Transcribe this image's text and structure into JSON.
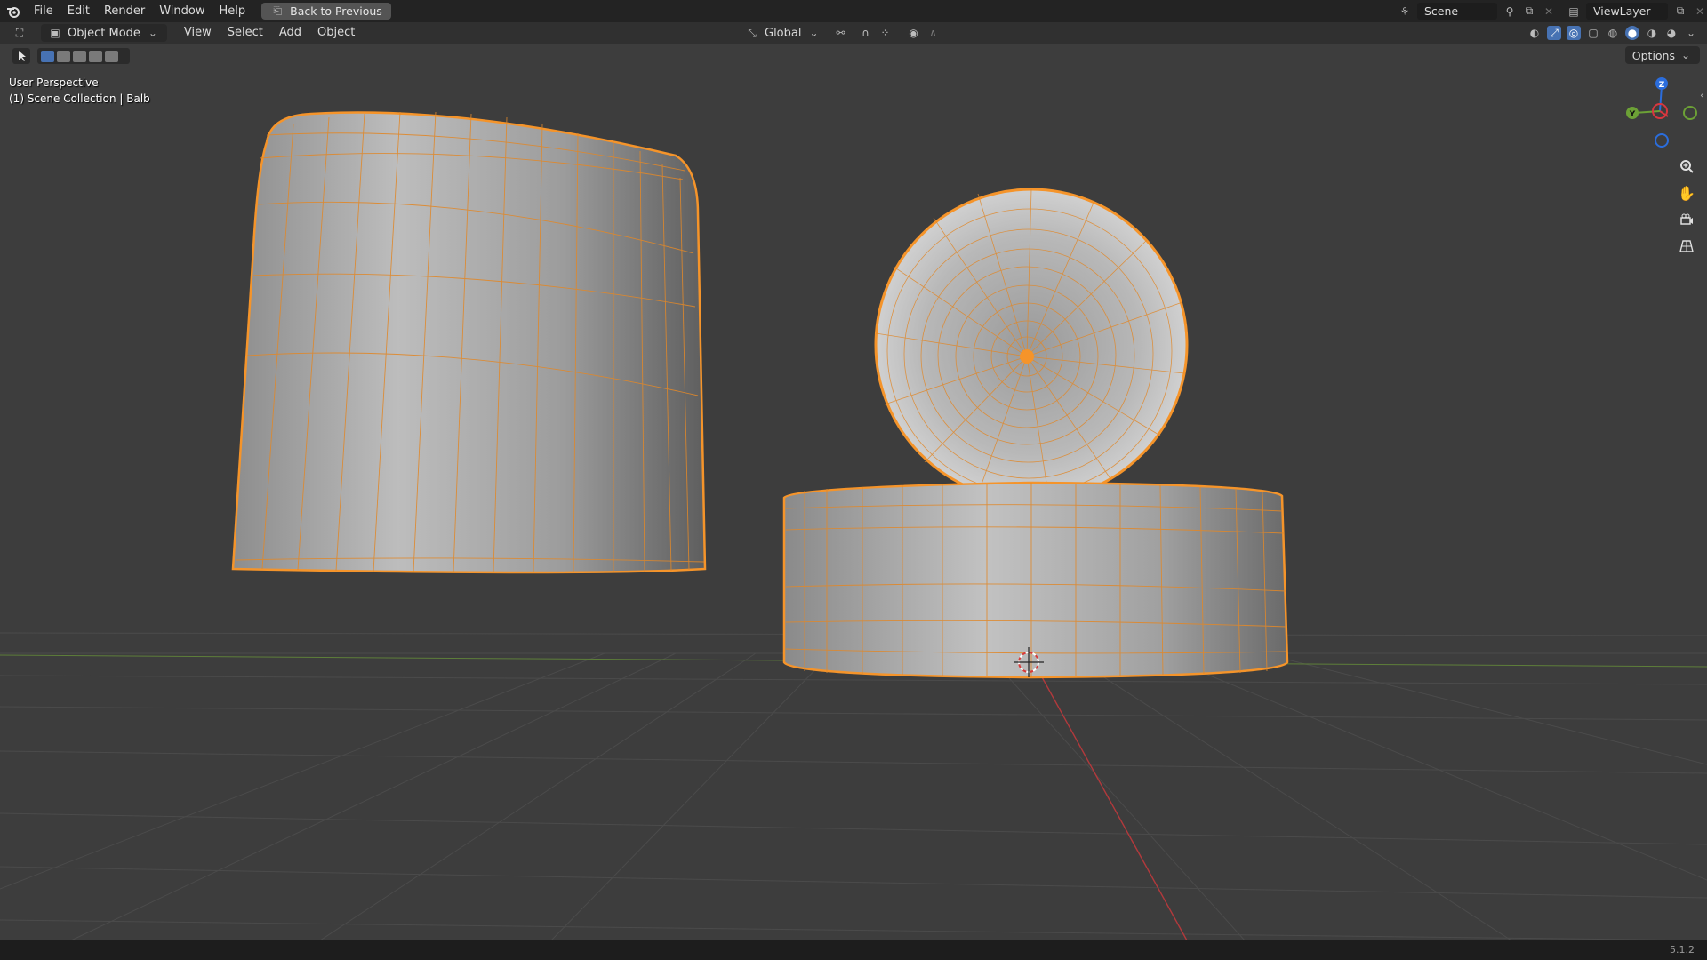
{
  "menubar": {
    "items": [
      "File",
      "Edit",
      "Render",
      "Window",
      "Help"
    ],
    "back_button": "Back to Previous",
    "scene": "Scene",
    "view_layer": "ViewLayer"
  },
  "header": {
    "mode": "Object Mode",
    "menus": [
      "View",
      "Select",
      "Add",
      "Object"
    ],
    "orientation": "Global",
    "options": "Options"
  },
  "viewport": {
    "perspective_label": "User Perspective",
    "collection_label": "(1) Scene Collection | Balb"
  },
  "colors": {
    "selection": "#f5942a",
    "x_axis": "#d8373f",
    "y_axis": "#6ca136",
    "z_axis": "#2b6ddc",
    "background": "#3d3d3d"
  },
  "status": {
    "version": "5.1.2"
  }
}
